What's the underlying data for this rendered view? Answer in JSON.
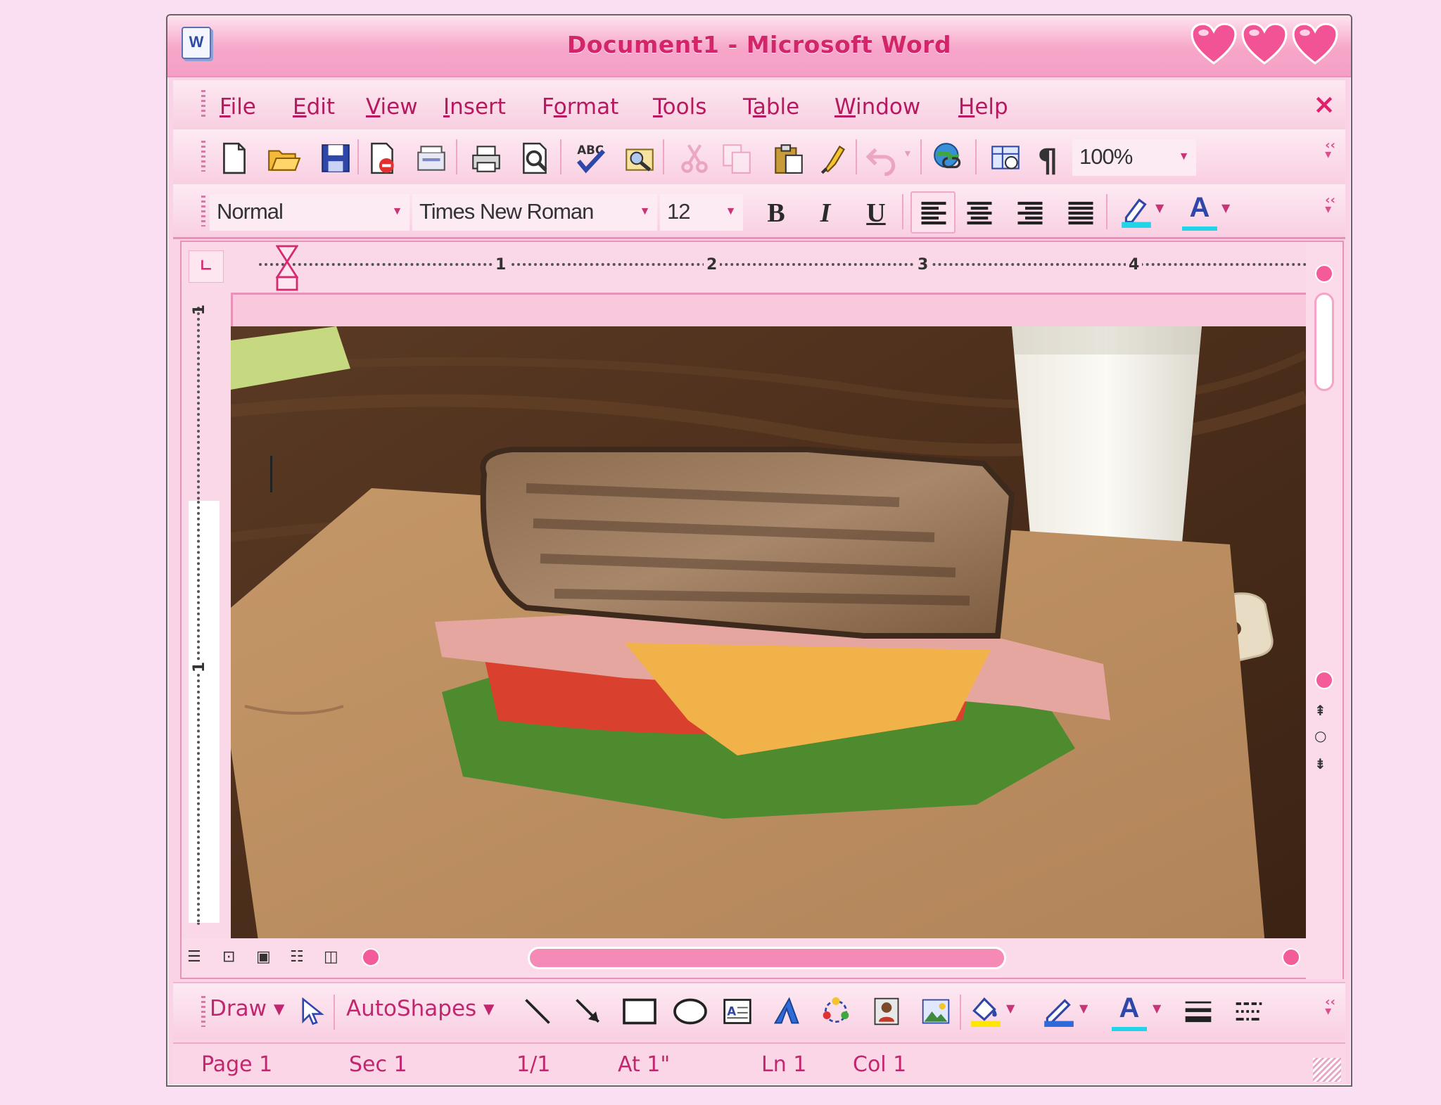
{
  "window": {
    "title": "Document1 - Microsoft Word",
    "app_icon": "W",
    "close_label": "×",
    "heart_color": "#f25394"
  },
  "menubar": {
    "items": [
      {
        "id": "file",
        "label": "File",
        "accel": "F"
      },
      {
        "id": "edit",
        "label": "Edit",
        "accel": "E"
      },
      {
        "id": "view",
        "label": "View",
        "accel": "V"
      },
      {
        "id": "insert",
        "label": "Insert",
        "accel": "I"
      },
      {
        "id": "format",
        "label": "Format",
        "accel": "o"
      },
      {
        "id": "tools",
        "label": "Tools",
        "accel": "T"
      },
      {
        "id": "table",
        "label": "Table",
        "accel": "a"
      },
      {
        "id": "window",
        "label": "Window",
        "accel": "W"
      },
      {
        "id": "help",
        "label": "Help",
        "accel": "H"
      }
    ]
  },
  "toolbar_standard": {
    "zoom": "100%",
    "icons": [
      "new-document-icon",
      "open-folder-icon",
      "save-icon",
      "permission-icon",
      "email-icon",
      "print-icon",
      "print-preview-icon",
      "spelling-icon",
      "research-icon",
      "cut-icon",
      "copy-icon",
      "paste-icon",
      "format-painter-icon",
      "undo-icon",
      "hyperlink-icon",
      "tables-borders-icon",
      "show-formatting-icon"
    ]
  },
  "toolbar_formatting": {
    "style": "Normal",
    "font": "Times New Roman",
    "size": "12",
    "bold_label": "B",
    "italic_label": "I",
    "underline_label": "U",
    "font_color_label": "A"
  },
  "ruler": {
    "numbers": [
      "1",
      "2",
      "3",
      "4"
    ],
    "vnumbers": [
      "1",
      "1"
    ]
  },
  "drawbar": {
    "draw_label": "Draw",
    "autoshapes_label": "AutoShapes"
  },
  "statusbar": {
    "page": "Page 1",
    "section": "Sec 1",
    "pages": "1/1",
    "at": "At 1\"",
    "line": "Ln 1",
    "col": "Col 1"
  },
  "colors": {
    "accent": "#e0206c",
    "menu_text": "#b8185f",
    "chrome_pink": "#fbd3e6"
  }
}
